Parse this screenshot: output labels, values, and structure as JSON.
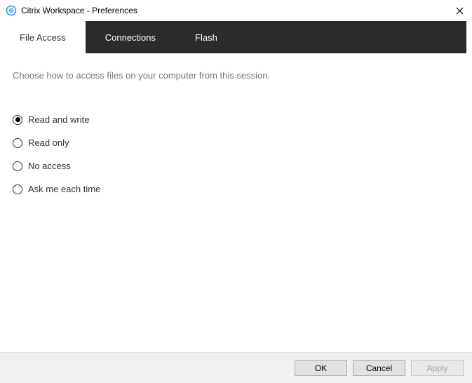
{
  "window": {
    "title": "Citrix Workspace - Preferences"
  },
  "tabs": {
    "file_access": "File Access",
    "connections": "Connections",
    "flash": "Flash"
  },
  "content": {
    "description": "Choose how to access files on your computer from this session."
  },
  "options": {
    "read_write": "Read and write",
    "read_only": "Read only",
    "no_access": "No access",
    "ask_each": "Ask me each time"
  },
  "buttons": {
    "ok": "OK",
    "cancel": "Cancel",
    "apply": "Apply"
  }
}
